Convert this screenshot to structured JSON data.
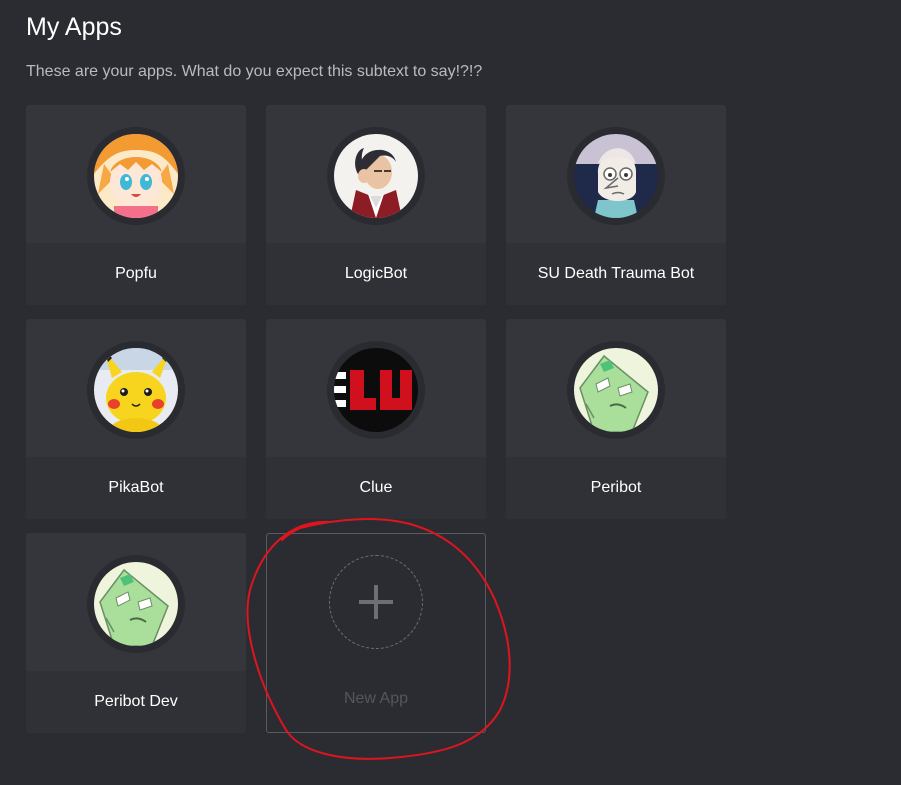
{
  "header": {
    "title": "My Apps",
    "subtitle": "These are your apps. What do you expect this subtext to say!?!?"
  },
  "apps": [
    {
      "name": "Popfu",
      "avatar_icon": "anime-girl-avatar-icon"
    },
    {
      "name": "LogicBot",
      "avatar_icon": "attorney-avatar-icon"
    },
    {
      "name": "SU Death Trauma Bot",
      "avatar_icon": "pearl-avatar-icon"
    },
    {
      "name": "PikaBot",
      "avatar_icon": "pikachu-avatar-icon"
    },
    {
      "name": "Clue",
      "avatar_icon": "clue-logo-avatar-icon"
    },
    {
      "name": "Peribot",
      "avatar_icon": "peridot-avatar-icon"
    },
    {
      "name": "Peribot Dev",
      "avatar_icon": "peridot-avatar-icon"
    }
  ],
  "new_app": {
    "label": "New App",
    "icon": "plus-icon"
  },
  "colors": {
    "background": "#2b2c31",
    "card": "#303136",
    "card_top": "#35363b",
    "annotation": "#e0141e"
  }
}
